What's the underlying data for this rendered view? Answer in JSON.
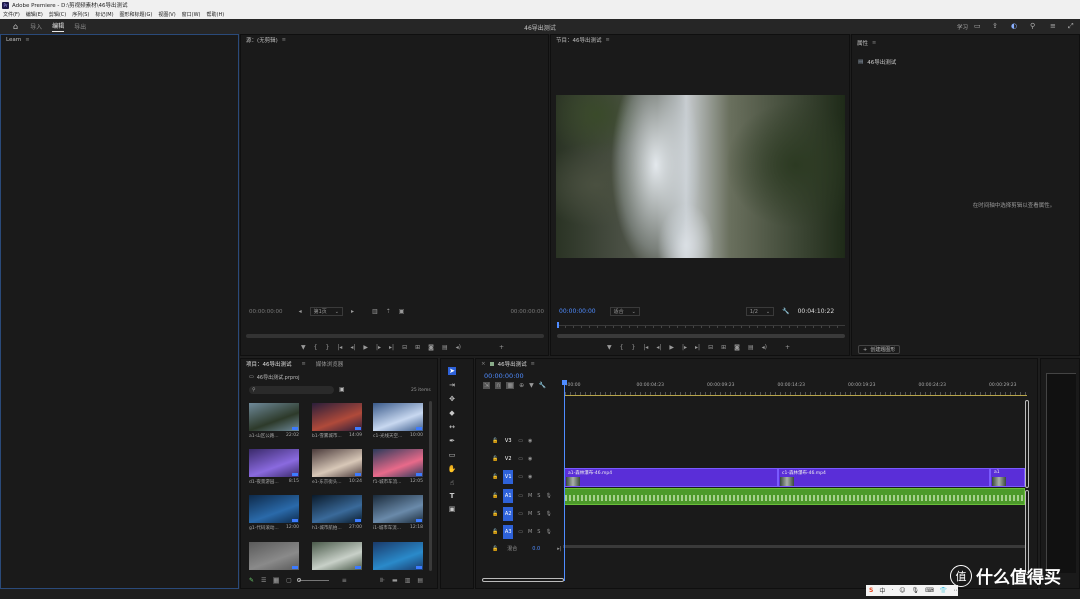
{
  "window": {
    "app_title": "Adobe Premiere - D:\\剪视频素材\\46导出测试",
    "logo_text": "Pr"
  },
  "menu": [
    "文件(F)",
    "编辑(E)",
    "剪辑(C)",
    "序列(S)",
    "标记(M)",
    "图形和标题(G)",
    "视图(V)",
    "窗口(W)",
    "帮助(H)"
  ],
  "workspace": {
    "tabs": [
      "导入",
      "编辑",
      "导出"
    ],
    "active_tab": "编辑",
    "project_title": "46导出测试",
    "right_label": "学习"
  },
  "learn_panel": {
    "title": "Learn"
  },
  "source_panel": {
    "title": "源：(无剪辑)",
    "timecode_left": "00:00:00:00",
    "page_select": "第1页",
    "timecode_right": "00:00:00:00"
  },
  "program_panel": {
    "title": "节目：46导出测试",
    "timecode": "00:00:00:00",
    "fit": "适合",
    "resolution": "1/2",
    "duration": "00:04:10:22"
  },
  "properties_panel": {
    "title": "属性",
    "sequence_name": "46导出测试",
    "hint": "在时间轴中选择剪辑以查看属性。",
    "create_button": "创建题图形"
  },
  "project_panel": {
    "tab_project": "项目：46导出测试",
    "tab_effects": "媒体浏览器",
    "file_name": "46导出测试.prproj",
    "item_count": "25 items",
    "thumbnails": [
      {
        "name": "a1-山区公路...",
        "duration": "22:02",
        "colors": [
          "#6f8a9a",
          "#2d3a2a"
        ]
      },
      {
        "name": "b1-雪雾城市...",
        "duration": "14:09",
        "colors": [
          "#2a1e3a",
          "#b04a3a"
        ]
      },
      {
        "name": "c1-光线天空...",
        "duration": "10:00",
        "colors": [
          "#3a5a8a",
          "#c8d8f0"
        ]
      },
      {
        "name": "d1-夜景游园...",
        "duration": "8:15",
        "colors": [
          "#3a2a6a",
          "#8a6adf"
        ]
      },
      {
        "name": "e1-东京街头...",
        "duration": "10:24",
        "colors": [
          "#4a3a3a",
          "#d8c8b8"
        ]
      },
      {
        "name": "f1-城市车流...",
        "duration": "12:05",
        "colors": [
          "#2a3a5a",
          "#e86a8a"
        ]
      },
      {
        "name": "g1-代码滚动...",
        "duration": "12:00",
        "colors": [
          "#0e2a4a",
          "#2a6aaa"
        ]
      },
      {
        "name": "h1-城市航拍...",
        "duration": "27:00",
        "colors": [
          "#0a1a2a",
          "#3a6a9a"
        ]
      },
      {
        "name": "i1-城市车流...",
        "duration": "12:18",
        "colors": [
          "#1a2a3a",
          "#6a8aaa"
        ]
      },
      {
        "name": "",
        "duration": "",
        "colors": [
          "#5a5a5a",
          "#8a8a8a"
        ]
      },
      {
        "name": "",
        "duration": "",
        "colors": [
          "#4a5a4a",
          "#c8d0c8"
        ]
      },
      {
        "name": "",
        "duration": "",
        "colors": [
          "#1a3a6a",
          "#2a8aca"
        ]
      }
    ]
  },
  "timeline": {
    "sequence_name": "46导出测试",
    "timecode": "00:00:00:00",
    "ruler": [
      ":00:00",
      "00:00:04:23",
      "00:00:09:23",
      "00:00:14:23",
      "00:00:19:23",
      "00:00:24:23",
      "00:00:29:23"
    ],
    "tracks_video": [
      "V3",
      "V2",
      "V1"
    ],
    "tracks_audio": [
      "A1",
      "A2",
      "A3"
    ],
    "mix_label": "混合",
    "mix_value": "0.0",
    "clips": [
      {
        "label": "a1-森林瀑布-46.mp4",
        "track": "V1"
      },
      {
        "label": "c1-森林瀑布-46.mp4",
        "track": "V1"
      },
      {
        "label": "a1",
        "track": "V1"
      }
    ],
    "audio_clip_track": "A1"
  },
  "watermark": {
    "text": "什么值得买",
    "logo_char": "值"
  },
  "ime_bar": [
    "S",
    "中",
    "·",
    "☺",
    "🎙",
    "⌨",
    "👕",
    "⋯"
  ],
  "colors": {
    "accent_blue": "#4f8cff",
    "clip_purple": "#5a2ed8",
    "audio_green": "#4c9a2a",
    "playhead": "#4f8cff"
  }
}
